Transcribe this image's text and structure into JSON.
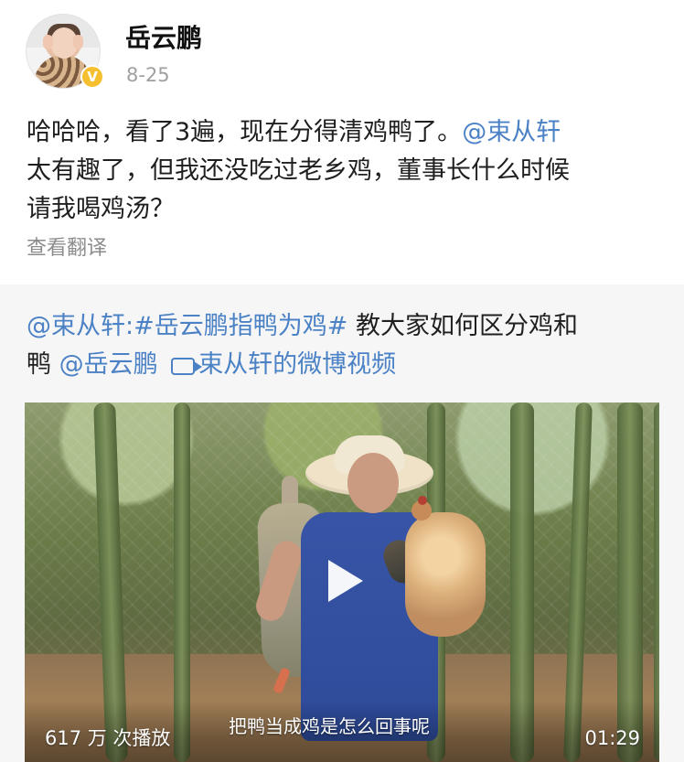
{
  "header": {
    "username": "岳云鹏",
    "date": "8-25",
    "badge": "V"
  },
  "post": {
    "line1_prefix": "哈哈哈，看了3遍，现在分得清鸡鸭了。",
    "line1_mention": "@束从轩",
    "line2": "太有趣了，但我还没吃过老乡鸡，董事长什么时候",
    "line3": "请我喝鸡汤？",
    "translate": "查看翻译"
  },
  "repost": {
    "mention_user": "@束从轩",
    "colon": ":",
    "topic": "#岳云鹏指鸭为鸡#",
    "text_after_topic": " 教大家如何区分鸡和",
    "line2_prefix": "鸭",
    "mention_target": "@岳云鹏",
    "video_label": "束从轩的微博视频"
  },
  "video": {
    "view_count": "617 万 次播放",
    "subtitle": "把鸭当成鸡是怎么回事呢",
    "duration": "01:29",
    "play_icon": "play-icon"
  }
}
